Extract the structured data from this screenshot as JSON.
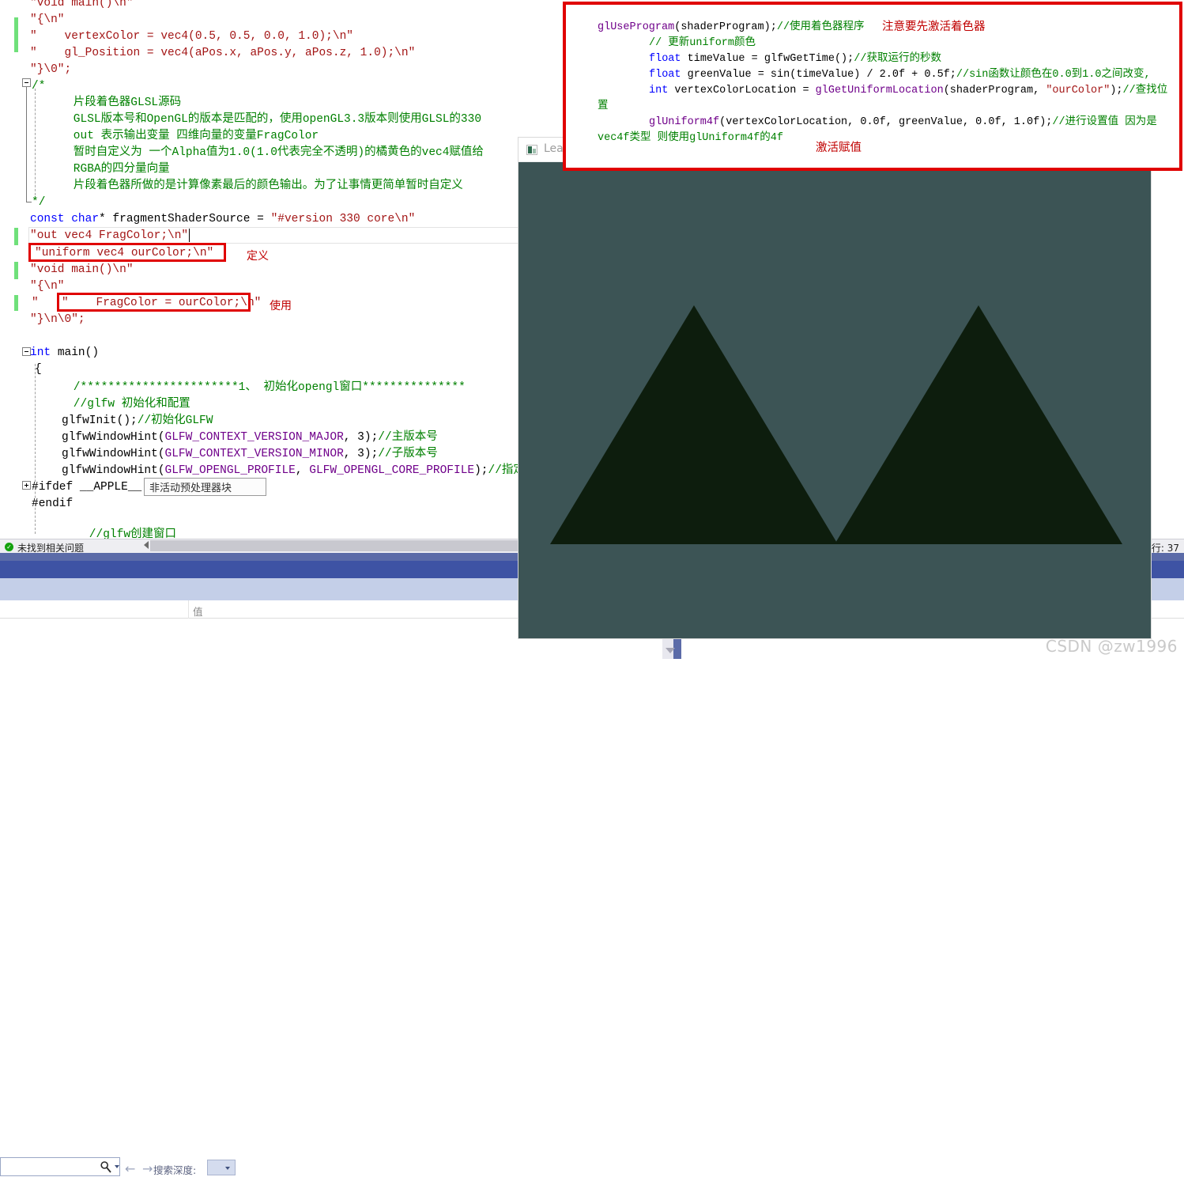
{
  "app": {
    "watermark": "CSDN @zw1996"
  },
  "editor": {
    "lines": [
      "\"void main()\\n\"",
      "\"{\\n\"",
      "\"    vertexColor = vec4(0.5, 0.5, 0.0, 1.0);\\n\"",
      "\"    gl_Position = vec4(aPos.x, aPos.y, aPos.z, 1.0);\\n\"",
      "\"}\\0\";",
      "/*",
      "    片段着色器GLSL源码",
      "    GLSL版本号和OpenGL的版本是匹配的，使用openGL3.3版本则使用GLSL的330",
      "    out 表示输出变量 四维向量的变量FragColor",
      "    暂时自定义为 一个Alpha值为1.0(1.0代表完全不透明)的橘黄色的vec4赋值给",
      "    RGBA的四分量向量",
      "    片段着色器所做的是计算像素最后的颜色输出。为了让事情更简单暂时自定义",
      "*/",
      "const char* fragmentShaderSource = \"#version 330 core\\n\"",
      "\"out vec4 FragColor;\\n\"",
      "\"uniform vec4 ourColor;\\n\"",
      "\"void main()\\n\"",
      "\"{\\n\"",
      "\"    FragColor = ourColor;\\n\"",
      "\"}\\n\\0\";",
      "int main()",
      "{",
      "    /***********************1、 初始化opengl窗口***************",
      "    //glfw 初始化和配置",
      "    glfwInit();//初始化GLFW",
      "    glfwWindowHint(GLFW_CONTEXT_VERSION_MAJOR, 3);//主版本号",
      "    glfwWindowHint(GLFW_CONTEXT_VERSION_MINOR, 3);//子版本号",
      "    glfwWindowHint(GLFW_OPENGL_PROFILE, GLFW_OPENGL_CORE_PROFILE);//指定",
      "#ifdef __APPLE__",
      "#endif",
      "    //glfw创建窗口"
    ],
    "inactive_block_tooltip": "非活动预处理器块",
    "annotation_define": "定义",
    "annotation_use": "使用"
  },
  "error_bar": {
    "status": "未找到相关问题",
    "status_icon": "check-circle-icon",
    "line_indicator": "行: 37"
  },
  "search_panel": {
    "search_value": "",
    "search_icon": "magnifier-icon",
    "back_arrow": "←",
    "forward_arrow": "→",
    "depth_label": "搜索深度:",
    "depth_value": "",
    "column_value_header": "值"
  },
  "gl_window": {
    "title": "LearnOpenGL",
    "icon": "app-icon",
    "minimize": "—",
    "maximize": "☐",
    "close": "✕",
    "background_color": "#3c5455",
    "triangle_color": "#0c1c0c"
  },
  "top_annotation_box": {
    "border_color": "#e00000",
    "lines": [
      {
        "code": "glUseProgram(shaderProgram);",
        "comment": "//使用着色器程序"
      },
      {
        "code": "",
        "comment": "// 更新uniform颜色"
      },
      {
        "code": "float timeValue = glfwGetTime();",
        "comment": "//获取运行的秒数"
      },
      {
        "code": "float greenValue = sin(timeValue) / 2.0f + 0.5f;",
        "comment": "//sin函数让颜色在0.0到1.0之间改变,"
      },
      {
        "code": "int vertexColorLocation = glGetUniformLocation(shaderProgram, \"ourColor\");",
        "comment": "//查找位置"
      },
      {
        "code": "glUniform4f(vertexColorLocation, 0.0f, greenValue, 0.0f, 1.0f);",
        "comment": "//进行设置值 因为是vec4f类型 则使用glUniform4f的4f"
      }
    ],
    "note_activate": "注意要先激活着色器",
    "note_assign": "激活赋值"
  }
}
